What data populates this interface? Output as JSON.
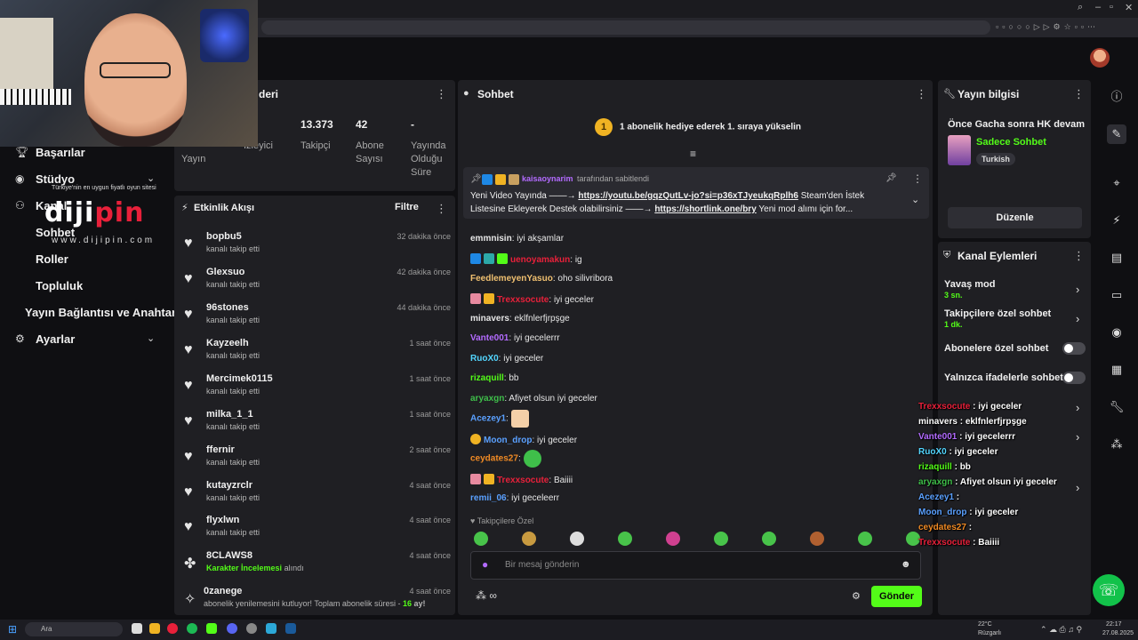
{
  "left_nav": {
    "items": [
      {
        "label": "Başarılar"
      },
      {
        "label": "Stüdyo"
      },
      {
        "label": "Kanal"
      },
      {
        "label": "Sohbet"
      },
      {
        "label": "Roller"
      },
      {
        "label": "Topluluk"
      },
      {
        "label": "Yayın Bağlantısı ve Anahtarı"
      },
      {
        "label": "Ayarlar"
      }
    ]
  },
  "watermark": {
    "top": "Türkiye'nin en uygun fiyatlı oyun sitesi",
    "logo_a": "diji",
    "logo_b": "pin",
    "bottom": "www.dijipin.com"
  },
  "stats_panel": {
    "title_fragment": "deri",
    "stats": [
      {
        "value": "",
        "label": "Yayın"
      },
      {
        "value": "",
        "label": "İzleyici"
      },
      {
        "value": "13.373",
        "label": "Takipçi"
      },
      {
        "value": "42",
        "label": "Abone Sayısı"
      },
      {
        "value": "-",
        "label": "Yayında Olduğu Süre"
      }
    ]
  },
  "activity": {
    "title": "Etkinlik Akışı",
    "filter_label": "Filtre",
    "events": [
      {
        "name": "bopbu5",
        "sub": "kanalı takip etti",
        "time": "32 dakika önce"
      },
      {
        "name": "Glexsuo",
        "sub": "kanalı takip etti",
        "time": "42 dakika önce"
      },
      {
        "name": "96stones",
        "sub": "kanalı takip etti",
        "time": "44 dakika önce"
      },
      {
        "name": "Kayzeelh",
        "sub": "kanalı takip etti",
        "time": "1 saat önce"
      },
      {
        "name": "Mercimek0115",
        "sub": "kanalı takip etti",
        "time": "1 saat önce"
      },
      {
        "name": "milka_1_1",
        "sub": "kanalı takip etti",
        "time": "1 saat önce"
      },
      {
        "name": "ffernir",
        "sub": "kanalı takip etti",
        "time": "2 saat önce"
      },
      {
        "name": "kutayzrclr",
        "sub": "kanalı takip etti",
        "time": "4 saat önce"
      },
      {
        "name": "flyxlwn",
        "sub": "kanalı takip etti",
        "time": "4 saat önce"
      },
      {
        "name": "8CLAWS8",
        "sub_highlight": "Karakter İncelemesi",
        "sub_rest": "alındı",
        "time": "4 saat önce"
      },
      {
        "name": "0zanege",
        "sub_long": "abonelik yenilemesini kutluyor! Toplam abonelik süresi -",
        "sub_num": "16",
        "sub_end": "ay!",
        "time": "4 saat önce"
      }
    ]
  },
  "chat": {
    "title": "Sohbet",
    "sub_banner": "1 abonelik hediye ederek 1. sıraya yükselin",
    "sub_banner_coin": "1",
    "pinned": {
      "user": "kaisaoynarim",
      "tag": "tarafından sabitlendi",
      "line1_a": "Yeni Video Yayında ——→",
      "line1_link": "https://youtu.be/gqzQutLv-jo?si=p36xTJyeukqRplh6",
      "line1_b": "Steam'den İstek",
      "line2_a": "Listesine Ekleyerek Destek olabilirsiniz ——→",
      "line2_link": "https://shortlink.one/bry",
      "line2_b": "Yeni mod alımı için for..."
    },
    "messages": [
      {
        "user": "emmnisin",
        "color": "#e6e6e6",
        "text": "iyi akşamlar",
        "badges": []
      },
      {
        "user": "uenoyamakun",
        "color": "#e8203a",
        "text": "ig",
        "badges": [
          "#1e88e5",
          "#2ca8a8",
          "#53fc18"
        ]
      },
      {
        "user": "FeedlemeyenYasuo",
        "color": "#f0c070",
        "text": "oho silivribora",
        "badges": []
      },
      {
        "user": "Trexxsocute",
        "color": "#e8203a",
        "text": "iyi geceler",
        "badges": [
          "#e88aa0",
          "#f0b323"
        ]
      },
      {
        "user": "minavers",
        "color": "#e6e6e6",
        "text": "eklfnlerfjrpşge",
        "badges": []
      },
      {
        "user": "Vante001",
        "color": "#b36bff",
        "text": "iyi gecelerrr",
        "badges": []
      },
      {
        "user": "RuoX0",
        "color": "#53d6ff",
        "text": "iyi geceler",
        "badges": []
      },
      {
        "user": "rizaquill",
        "color": "#53fc18",
        "text": "bb",
        "badges": []
      },
      {
        "user": "aryaxgn",
        "color": "#3fbf4a",
        "text": "Afiyet olsun iyi geceler",
        "badges": []
      },
      {
        "user": "Acezey1",
        "color": "#5aa0ff",
        "text": "",
        "badges": [],
        "emote": true
      },
      {
        "user": "Moon_drop",
        "color": "#5aa0ff",
        "text": "iyi geceler",
        "badges": [
          "#f0b323"
        ]
      },
      {
        "user": "ceydates27",
        "color": "#f08a24",
        "text": "",
        "badges": [],
        "emote": true
      },
      {
        "user": "Trexxsocute",
        "color": "#e8203a",
        "text": "Baiiii",
        "badges": [
          "#e88aa0",
          "#f0b323"
        ]
      },
      {
        "user": "remii_06",
        "color": "#5aa0ff",
        "text": "iyi geceleerr",
        "badges": []
      }
    ],
    "followers_only": "Takipçilere Özel",
    "input_placeholder": "Bir mesaj gönderin",
    "send_label": "Gönder"
  },
  "stream_info": {
    "title": "Yayın bilgisi",
    "stream_title": "Önce Gacha sonra HK devam",
    "category": "Sadece Sohbet",
    "language": "Turkish",
    "edit_label": "Düzenle"
  },
  "channel_actions": {
    "title": "Kanal Eylemleri",
    "items": [
      {
        "label": "Yavaş mod",
        "sub": "3 sn."
      },
      {
        "label": "Takipçilere özel sohbet",
        "sub": "1 dk."
      },
      {
        "label": "Abonelere özel sohbet"
      },
      {
        "label": "Yalnızca ifadelerle sohbet"
      }
    ]
  },
  "overlay_chat": [
    {
      "user": "Trexxsocute",
      "color": "#e8203a",
      "text": "iyi geceler"
    },
    {
      "user": "minavers",
      "color": "#ffffff",
      "text": "eklfnlerfjrpşge"
    },
    {
      "user": "Vante001",
      "color": "#b36bff",
      "text": "iyi gecelerrr"
    },
    {
      "user": "RuoX0",
      "color": "#53d6ff",
      "text": "iyi geceler"
    },
    {
      "user": "rizaquill",
      "color": "#53fc18",
      "text": "bb"
    },
    {
      "user": "aryaxgn",
      "color": "#3fbf4a",
      "text": "Afiyet olsun iyi geceler"
    },
    {
      "user": "Acezey1",
      "color": "#5aa0ff",
      "text": ""
    },
    {
      "user": "Moon_drop",
      "color": "#5aa0ff",
      "text": "iyi geceler"
    },
    {
      "user": "ceydates27",
      "color": "#f08a24",
      "text": ""
    },
    {
      "user": "Trexxsocute",
      "color": "#e8203a",
      "text": "Baiiii"
    }
  ],
  "taskbar": {
    "search": "Ara",
    "weather": "22°C",
    "weather_sub": "Rüzgarlı",
    "time": "22:17",
    "date": "27.08.2025"
  },
  "colors": {
    "accent": "#53fc18",
    "panel": "#1f1f23",
    "bg": "#0f0f12"
  }
}
